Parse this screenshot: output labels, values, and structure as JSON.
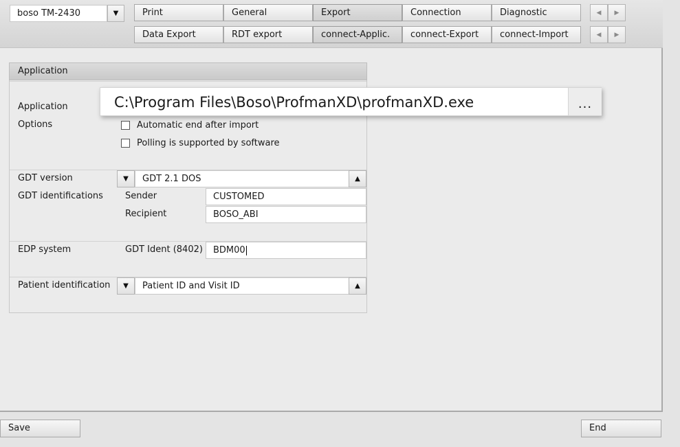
{
  "device": {
    "selected": "boso TM-2430"
  },
  "tabs_row1": [
    {
      "label": "Print",
      "active": false
    },
    {
      "label": "General",
      "active": false
    },
    {
      "label": "Export",
      "active": true
    },
    {
      "label": "Connection",
      "active": false
    },
    {
      "label": "Diagnostic",
      "active": false
    }
  ],
  "tabs_row2": [
    {
      "label": "Data Export",
      "active": false
    },
    {
      "label": "RDT export",
      "active": false
    },
    {
      "label": "connect-Applic.",
      "active": true
    },
    {
      "label": "connect-Export",
      "active": false
    },
    {
      "label": "connect-Import",
      "active": false
    }
  ],
  "panel": {
    "title": "Application",
    "application_label": "Application",
    "application_path": "C:\\Program Files\\Boso\\ProfmanXD\\profmanXD.exe",
    "browse_label": "...",
    "options_label": "Options",
    "options": [
      {
        "label": "Automatic end after import",
        "checked": false
      },
      {
        "label": "Polling is supported by software",
        "checked": false
      }
    ],
    "gdt_version_label": "GDT version",
    "gdt_version_value": "GDT 2.1 DOS",
    "gdt_ident_label": "GDT identifications",
    "sender_label": "Sender",
    "sender_value": "CUSTOMED",
    "recipient_label": "Recipient",
    "recipient_value": "BOSO_ABI",
    "edp_label": "EDP system",
    "gdt_ident_8402_label": "GDT Ident (8402)",
    "gdt_ident_8402_value": "BDM00",
    "patient_id_label": "Patient identification",
    "patient_id_value": "Patient ID and Visit ID"
  },
  "footer": {
    "save_label": "Save",
    "end_label": "End"
  }
}
